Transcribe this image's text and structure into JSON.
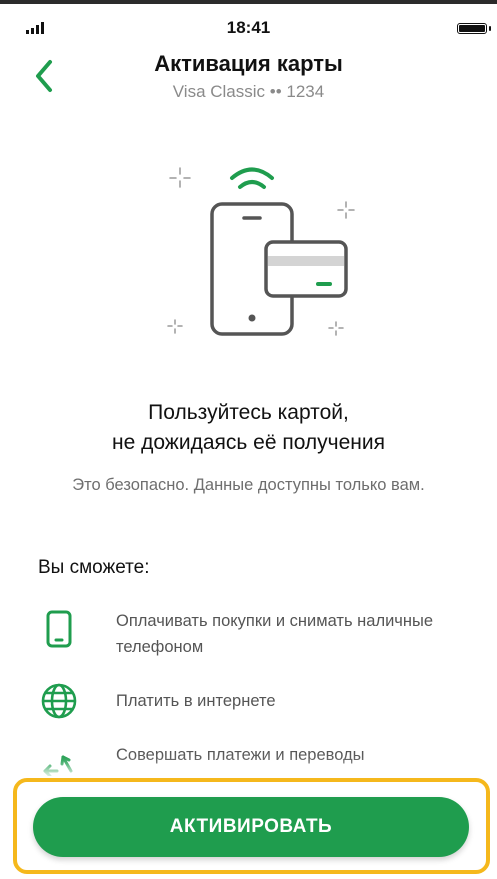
{
  "status_bar": {
    "time": "18:41"
  },
  "header": {
    "title": "Активация карты",
    "subtitle": "Visa Classic •• 1234"
  },
  "promo": {
    "headline_line1": "Пользуйтесь картой,",
    "headline_line2": "не дожидаясь её получения",
    "description": "Это безопасно. Данные доступны только вам."
  },
  "features": {
    "title": "Вы сможете:",
    "items": [
      {
        "icon": "phone-icon",
        "label": "Оплачивать покупки и снимать наличные телефоном"
      },
      {
        "icon": "globe-icon",
        "label": "Платить в интернете"
      },
      {
        "icon": "transfer-arrows-icon",
        "label": "Совершать платежи и переводы"
      }
    ]
  },
  "actions": {
    "activate_label": "АКТИВИРОВАТЬ"
  },
  "colors": {
    "accent": "#1f9d4e",
    "highlight": "#f5b81c",
    "text": "#111111",
    "muted": "#6e6e6e"
  }
}
